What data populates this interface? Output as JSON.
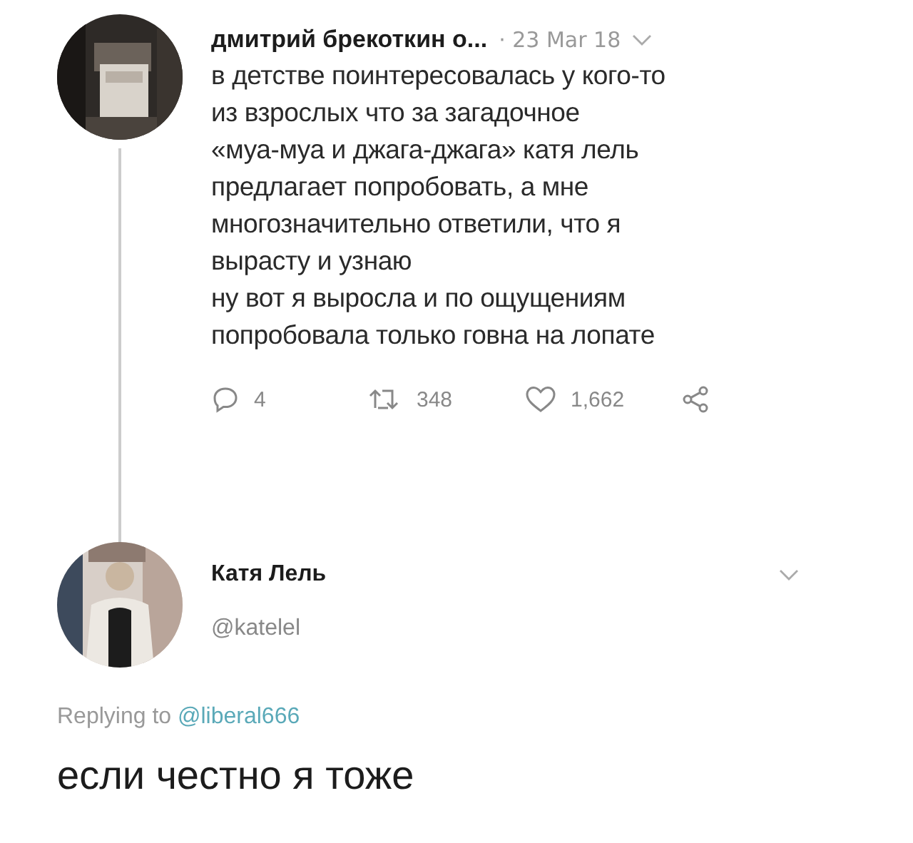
{
  "tweet": {
    "author": "дмитрий брекоткин о...",
    "date": "· 23 Mar 18",
    "text": "в детстве поинтересовалась у кого-то\nиз взрослых что за загадочное\n«муа-муа и джага-джага» катя лель\nпредлагает попробовать, а мне\nмногозначительно ответили, что я\nвырасту и узнаю\nну вот я выросла и по ощущениям\nпопробовала только говна на лопате",
    "actions": [
      {
        "kind": "reply",
        "count": "4"
      },
      {
        "kind": "retweet",
        "count": "348"
      },
      {
        "kind": "like",
        "count": "1,662"
      },
      {
        "kind": "share"
      }
    ]
  },
  "reply": {
    "name": "Катя Лель",
    "handle": "@katelel",
    "replying_label": "Replying to",
    "replying_to": "@liberal666",
    "text": "если честно я тоже"
  }
}
